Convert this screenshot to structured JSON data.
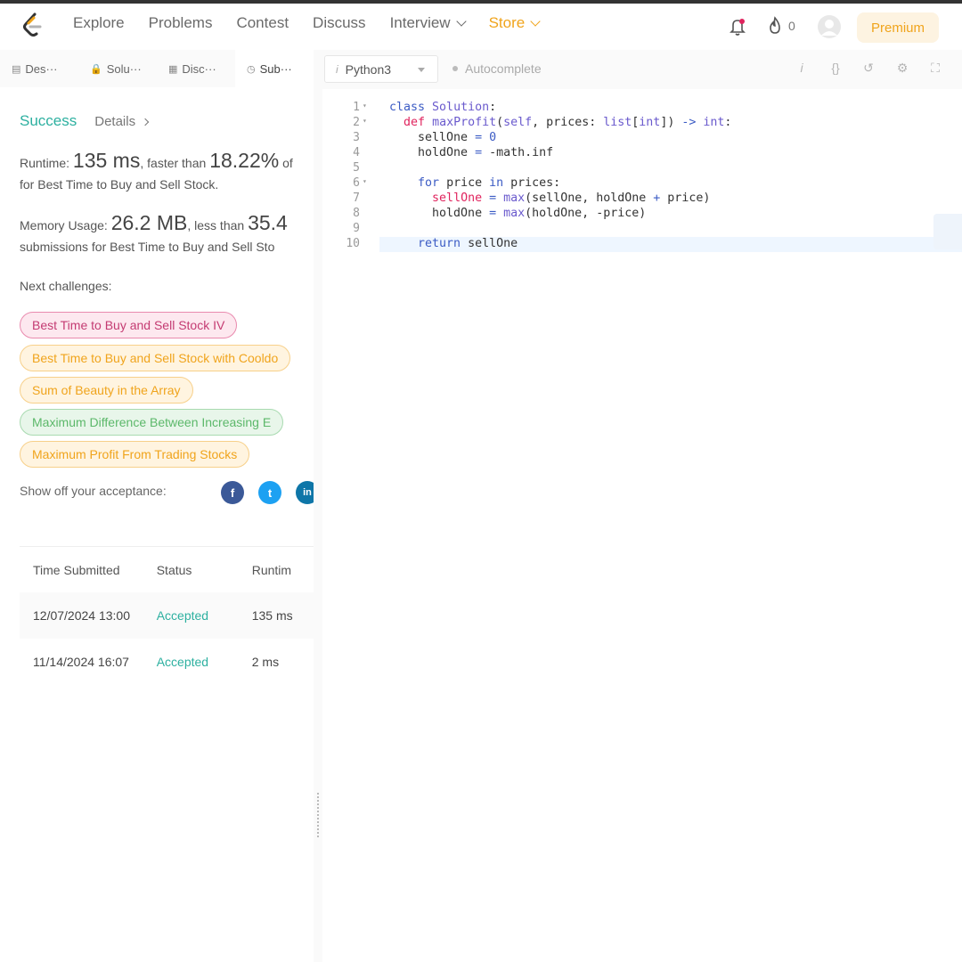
{
  "nav": {
    "items": [
      "Explore",
      "Problems",
      "Contest",
      "Discuss"
    ],
    "interview": "Interview",
    "store": "Store",
    "streak_count": "0",
    "premium": "Premium"
  },
  "tabs": [
    {
      "label": "Des···",
      "icon": "document-icon"
    },
    {
      "label": "Solu···",
      "icon": "lock-icon"
    },
    {
      "label": "Disc···",
      "icon": "discuss-icon"
    },
    {
      "label": "Sub···",
      "icon": "clock-icon"
    }
  ],
  "result": {
    "status": "Success",
    "details": "Details",
    "runtime_label": "Runtime: ",
    "runtime_value": "135 ms",
    "runtime_faster": ", faster than ",
    "runtime_pct": "18.22%",
    "runtime_of": " of",
    "runtime_line2": "for Best Time to Buy and Sell Stock.",
    "memory_label": "Memory Usage: ",
    "memory_value": "26.2 MB",
    "memory_less": ", less than ",
    "memory_pct": "35.4",
    "memory_line2": "submissions for Best Time to Buy and Sell Sto"
  },
  "next": {
    "label": "Next challenges:",
    "items": [
      {
        "label": "Best Time to Buy and Sell Stock IV",
        "color": "pink"
      },
      {
        "label": "Best Time to Buy and Sell Stock with Cooldo",
        "color": "orange"
      },
      {
        "label": "Sum of Beauty in the Array",
        "color": "orange"
      },
      {
        "label": "Maximum Difference Between Increasing E",
        "color": "green"
      },
      {
        "label": "Maximum Profit From Trading Stocks",
        "color": "orange"
      }
    ]
  },
  "share": {
    "label": "Show off your acceptance:",
    "networks": [
      "f",
      "t",
      "in"
    ]
  },
  "submissions": {
    "headers": [
      "Time Submitted",
      "Status",
      "Runtim"
    ],
    "rows": [
      {
        "time": "12/07/2024 13:00",
        "status": "Accepted",
        "runtime": "135 ms"
      },
      {
        "time": "11/14/2024 16:07",
        "status": "Accepted",
        "runtime": "2 ms"
      }
    ]
  },
  "editor": {
    "language": "Python3",
    "autocomplete": "Autocomplete",
    "lines": [
      "1",
      "2",
      "3",
      "4",
      "5",
      "6",
      "7",
      "8",
      "9",
      "10"
    ]
  },
  "colors": {
    "accent_green": "#2db0a0",
    "store_orange": "#f0a41c",
    "pink": "#c43b72"
  }
}
